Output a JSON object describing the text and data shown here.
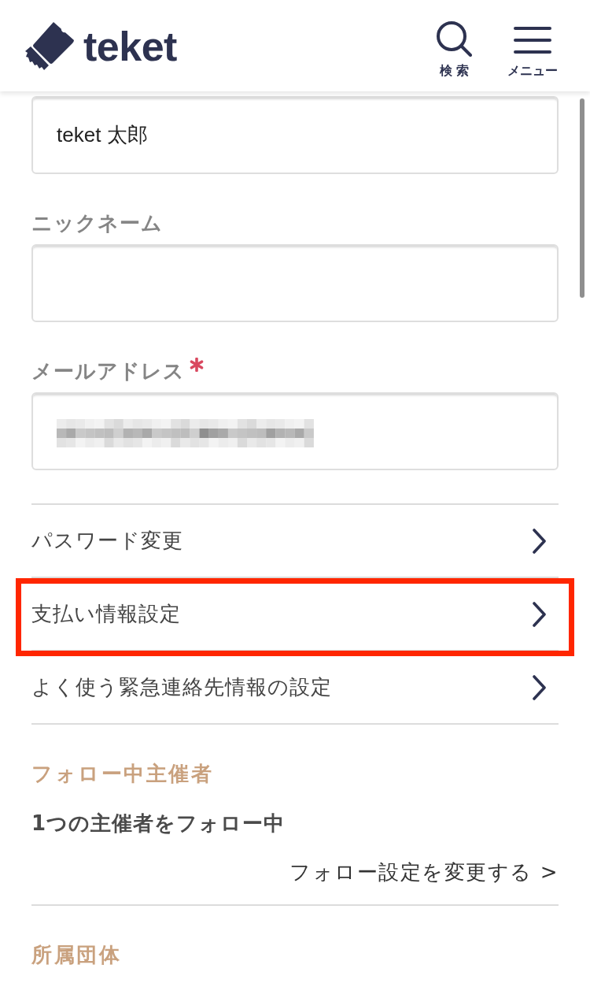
{
  "header": {
    "logo_text": "teket",
    "nav": [
      {
        "kind": "search",
        "label": "検索"
      },
      {
        "kind": "menu",
        "label": "メニュー"
      }
    ]
  },
  "form": {
    "fields": [
      {
        "value": "teket 太郎",
        "value_obscured": false
      },
      {
        "label": "ニックネーム",
        "required": false,
        "value_obscured": false
      },
      {
        "label": "メールアドレス",
        "required": true,
        "value_obscured": true
      }
    ]
  },
  "settings_links": [
    {
      "label": "パスワード変更",
      "highlighted": false
    },
    {
      "label": "支払い情報設定",
      "highlighted": true
    },
    {
      "label": "よく使う緊急連絡先情報の設定",
      "highlighted": false
    }
  ],
  "sections": [
    {
      "heading": "フォロー中主催者",
      "summary": "1つの主催者をフォロー中",
      "link": "フォロー設定を変更する >"
    },
    {
      "heading": "所属団体"
    }
  ]
}
